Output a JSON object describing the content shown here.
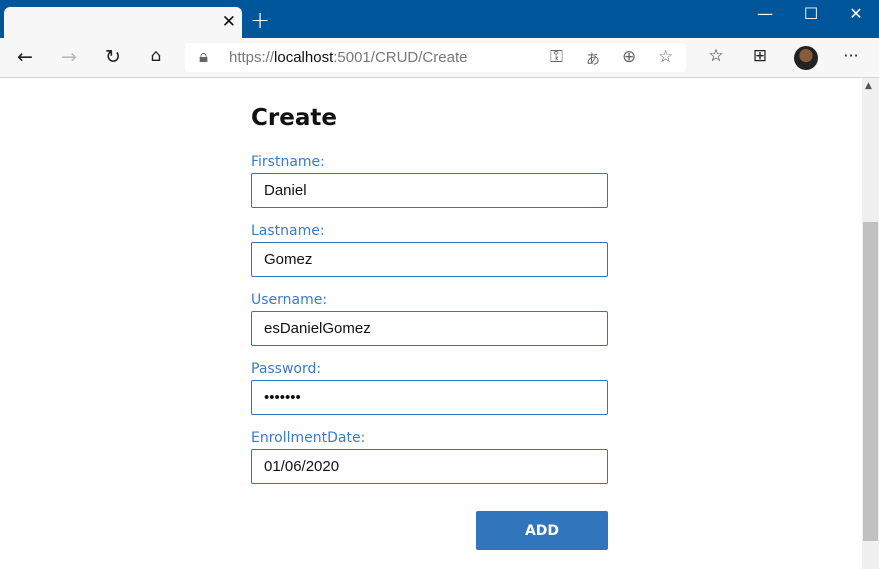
{
  "browser": {
    "tab_close": "✕",
    "new_tab": "+",
    "window": {
      "minimize": "—",
      "maximize": "☐",
      "close": "✕"
    },
    "url_prefix": "https://",
    "url_host": "localhost",
    "url_rest": ":5001/CRUD/Create",
    "more": "···"
  },
  "page": {
    "title": "Create",
    "fields": [
      {
        "label": "Firstname:",
        "value": "Daniel"
      },
      {
        "label": "Lastname:",
        "value": "Gomez"
      },
      {
        "label": "Username:",
        "value": "esDanielGomez"
      },
      {
        "label": "Password:",
        "value": "•••••••"
      },
      {
        "label": "EnrollmentDate:",
        "value": "01/06/2020"
      }
    ],
    "add_label": "ADD"
  },
  "colors": {
    "titlebar": "#00569a",
    "accent": "#3175bc",
    "label": "#3a7bc8"
  }
}
